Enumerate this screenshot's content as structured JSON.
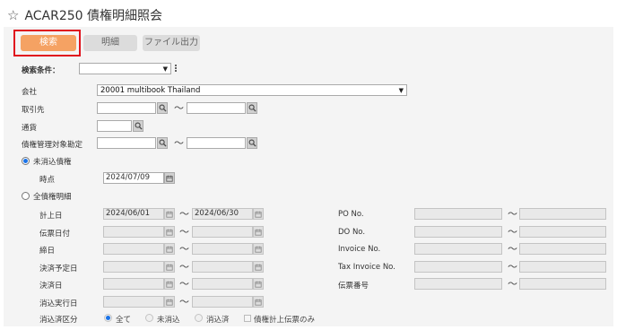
{
  "header": {
    "title": "ACAR250 債権明細照会"
  },
  "toolbar": {
    "search": "検索",
    "detail": "明細",
    "export": "ファイル出力"
  },
  "filters": {
    "search_condition_label": "検索条件：",
    "search_condition_value": "",
    "company_label": "会社",
    "company_value": "20001 multibook Thailand",
    "partner_label": "取引先",
    "currency_label": "通貨",
    "account_label": "債権管理対象勘定",
    "tilde": "〜"
  },
  "mode": {
    "unreconciled_label": "未消込債権",
    "point_in_time_label": "時点",
    "point_in_time_value": "2024/07/09",
    "all_label": "全債権明細",
    "selected": "unreconciled"
  },
  "dates": {
    "posting_label": "計上日",
    "posting_from": "2024/06/01",
    "posting_to": "2024/06/30",
    "slip_label": "伝票日付",
    "cutoff_label": "締日",
    "planned_label": "決済予定日",
    "settlement_label": "決済日",
    "reconcile_label": "消込実行日"
  },
  "refs": {
    "po_label": "PO No.",
    "do_label": "DO No.",
    "invoice_label": "Invoice No.",
    "tax_invoice_label": "Tax Invoice No.",
    "slip_number_label": "伝票番号"
  },
  "status": {
    "label": "消込済区分",
    "all": "全て",
    "unreconciled": "未消込",
    "reconciled": "消込済",
    "checkbox_label": "債権計上伝票のみ",
    "selected": "all"
  },
  "colors": {
    "search_button": "#f5a263",
    "highlight_border": "#e0141e",
    "radio_checked": "#1a73e8"
  }
}
